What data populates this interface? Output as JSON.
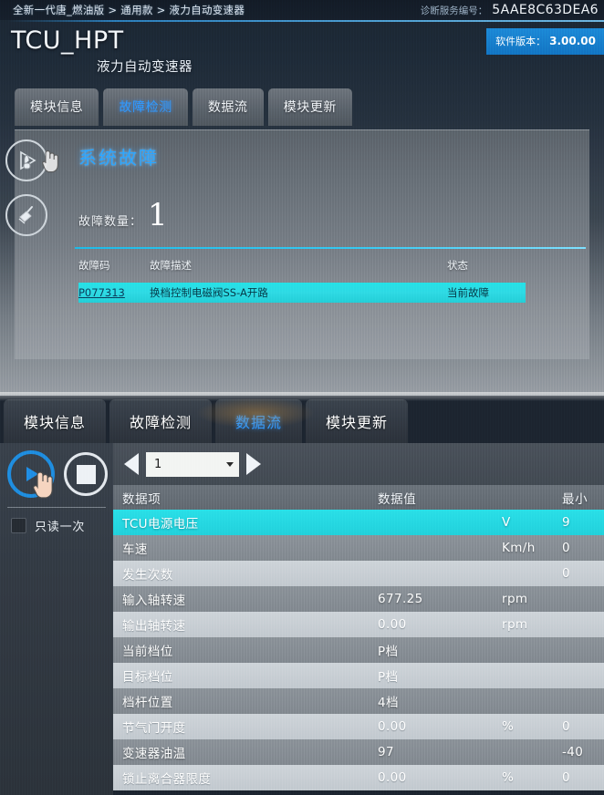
{
  "top_panel": {
    "breadcrumb": "全新一代唐_燃油版 > 通用款 > 液力自动变速器",
    "diag_service_label": "诊断服务编号：",
    "diag_service_value": "5AAE8C63DEA6",
    "app_title": "TCU_HPT",
    "app_subtitle": "液力自动变速器",
    "sw_version_label": "软件版本：",
    "sw_version_value": "3.00.00",
    "tabs": [
      {
        "label": "模块信息",
        "active": false
      },
      {
        "label": "故障检测",
        "active": true
      },
      {
        "label": "数据流",
        "active": false
      },
      {
        "label": "模块更新",
        "active": false
      }
    ],
    "section_title": "系统故障",
    "fault_count_label": "故障数量：",
    "fault_count_value": "1",
    "fault_table": {
      "headers": {
        "code": "故障码",
        "desc": "故障描述",
        "status": "状态"
      },
      "rows": [
        {
          "code": "P077313",
          "desc": "换档控制电磁阀SS-A开路",
          "status": "当前故障"
        }
      ]
    },
    "icons": {
      "scan": "scan-play-icon",
      "clear": "clear-broom-icon"
    }
  },
  "bottom_panel": {
    "tabs": [
      {
        "label": "模块信息",
        "active": false
      },
      {
        "label": "故障检测",
        "active": false
      },
      {
        "label": "数据流",
        "active": true
      },
      {
        "label": "模块更新",
        "active": false
      }
    ],
    "toolbar": {
      "play_label": "play-button",
      "stop_label": "stop-button",
      "read_once_label": "只读一次",
      "read_once_checked": false
    },
    "pager": {
      "page_value": "1",
      "prev_label": "prev-page",
      "next_label": "next-page"
    },
    "data_table": {
      "headers": {
        "item": "数据项",
        "value": "数据值",
        "unit": "",
        "min": "最小"
      },
      "rows": [
        {
          "item": "TCU电源电压",
          "value": "",
          "unit": "V",
          "min": "9",
          "style": "sel"
        },
        {
          "item": "车速",
          "value": "",
          "unit": "Km/h",
          "min": "0",
          "style": "dark"
        },
        {
          "item": "发生次数",
          "value": "",
          "unit": "",
          "min": "0",
          "style": "light"
        },
        {
          "item": "输入轴转速",
          "value": "677.25",
          "unit": "rpm",
          "min": "",
          "style": "dark"
        },
        {
          "item": "输出轴转速",
          "value": "0.00",
          "unit": "rpm",
          "min": "",
          "style": "light"
        },
        {
          "item": "当前档位",
          "value": "P档",
          "unit": "",
          "min": "",
          "style": "dark"
        },
        {
          "item": "目标档位",
          "value": "P档",
          "unit": "",
          "min": "",
          "style": "light"
        },
        {
          "item": "档杆位置",
          "value": "4档",
          "unit": "",
          "min": "",
          "style": "dark"
        },
        {
          "item": "节气门开度",
          "value": "0.00",
          "unit": "%",
          "min": "0",
          "style": "light"
        },
        {
          "item": "变速器油温",
          "value": "97",
          "unit": "",
          "min": "-40",
          "style": "dark"
        },
        {
          "item": "锁止离合器限度",
          "value": "0.00",
          "unit": "%",
          "min": "0",
          "style": "light"
        }
      ]
    }
  },
  "colors": {
    "accent_blue": "#2f9bff",
    "cyan_highlight": "#2ae0e8",
    "badge_blue": "#1d8bd8",
    "panel_dark": "#1d2530"
  }
}
